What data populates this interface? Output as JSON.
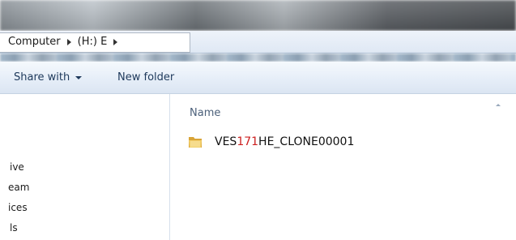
{
  "address": {
    "crumbs": [
      "Computer",
      "(H:) E"
    ]
  },
  "toolbar": {
    "share_label": "Share with",
    "new_folder_label": "New folder"
  },
  "nav": {
    "items": [
      "ive",
      "eam",
      "ices",
      "ls"
    ]
  },
  "files": {
    "column_header": "Name",
    "rows": [
      {
        "name_prefix": "VES",
        "name_highlight": "171",
        "name_suffix": "HE_CLONE00001",
        "icon": "folder-icon"
      }
    ]
  },
  "colors": {
    "highlight": "#cc1f1f",
    "folder": "#e8b84a",
    "command_bar_text": "#1e395b"
  }
}
